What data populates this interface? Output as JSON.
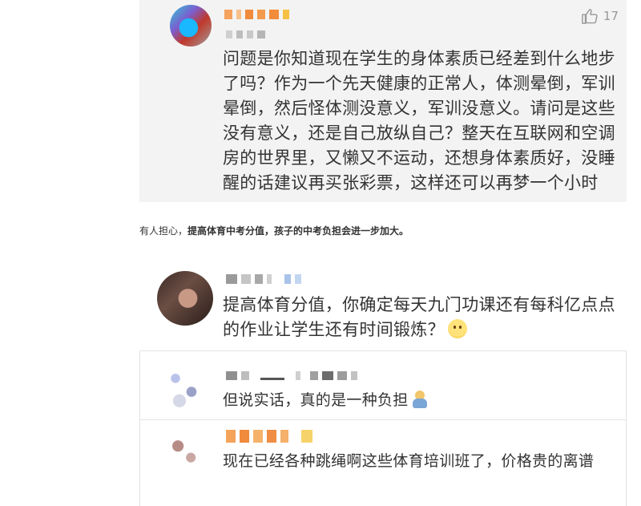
{
  "comment1": {
    "likes": "17",
    "text": "问题是你知道现在学生的身体素质已经差到什么地步了吗？作为一个先天健康的正常人，体测晕倒，军训晕倒，然后怪体测没意义，军训没意义。请问是这些没有意义，还是自己放纵自己？整天在互联网和空调房的世界里，又懒又不运动，还想身体素质好，没睡醒的话建议再买张彩票，这样还可以再梦一个小时"
  },
  "caption": {
    "prefix": "有人担心，",
    "bold": "提高体育中考分值，孩子的中考负担会进一步加大。"
  },
  "comment2": {
    "text": "提高体育分值，你确定每天九门功课还有每科亿点点的作业让学生还有时间锻炼？"
  },
  "replies": [
    {
      "text": "但说实话，真的是一种负担"
    },
    {
      "text": "现在已经各种跳绳啊这些体育培训班了，价格贵的离谱"
    }
  ],
  "icons": {
    "like": "thumbs-up-icon",
    "emoji_smile": "smile-emoji-icon",
    "emoji_burden": "person-burden-emoji-icon"
  },
  "colors": {
    "card_background": "#f3f3f3",
    "text": "#333333",
    "muted": "#999999",
    "divider": "#e3e3e3"
  }
}
